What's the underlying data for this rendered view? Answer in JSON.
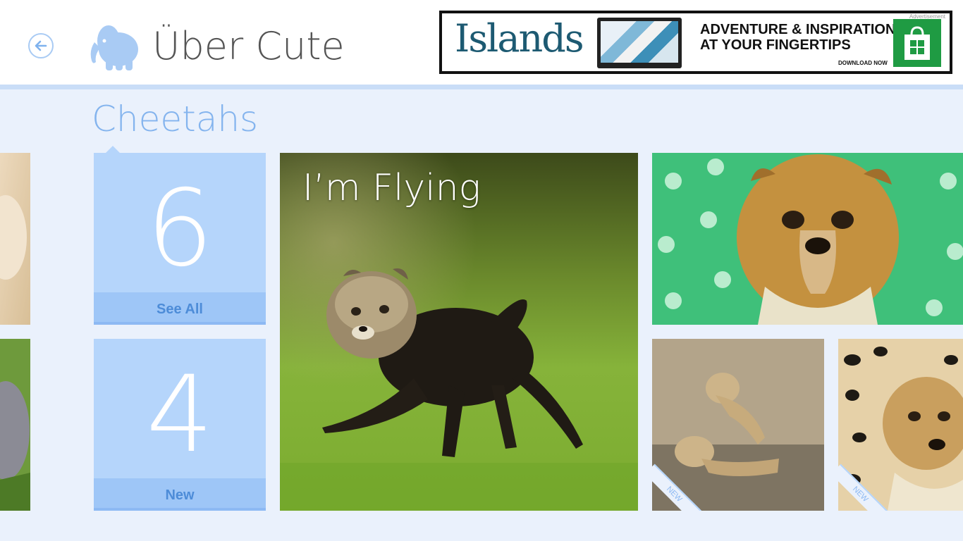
{
  "header": {
    "app_title": "Über Cute",
    "back_icon": "back-arrow-icon",
    "logo_icon": "elephant-logo-icon"
  },
  "ad": {
    "label": "Advertisement",
    "brand": "Islands",
    "tagline": "ADVENTURE & INSPIRATION\nAT YOUR FINGERTIPS",
    "cta": "DOWNLOAD NOW",
    "store_icon": "windows-store-icon"
  },
  "section": {
    "title": "Cheetahs"
  },
  "tiles": {
    "see_all": {
      "count": "6",
      "label": "See All"
    },
    "new": {
      "count": "4",
      "label": "New"
    }
  },
  "photos": {
    "featured_caption": "I’m Flying",
    "new_badge": "NEW"
  },
  "colors": {
    "background": "#eaf1fc",
    "tile_blue": "#b5d5fb",
    "accent_text": "#84b4ee",
    "label_blue": "#4d8cd8"
  }
}
